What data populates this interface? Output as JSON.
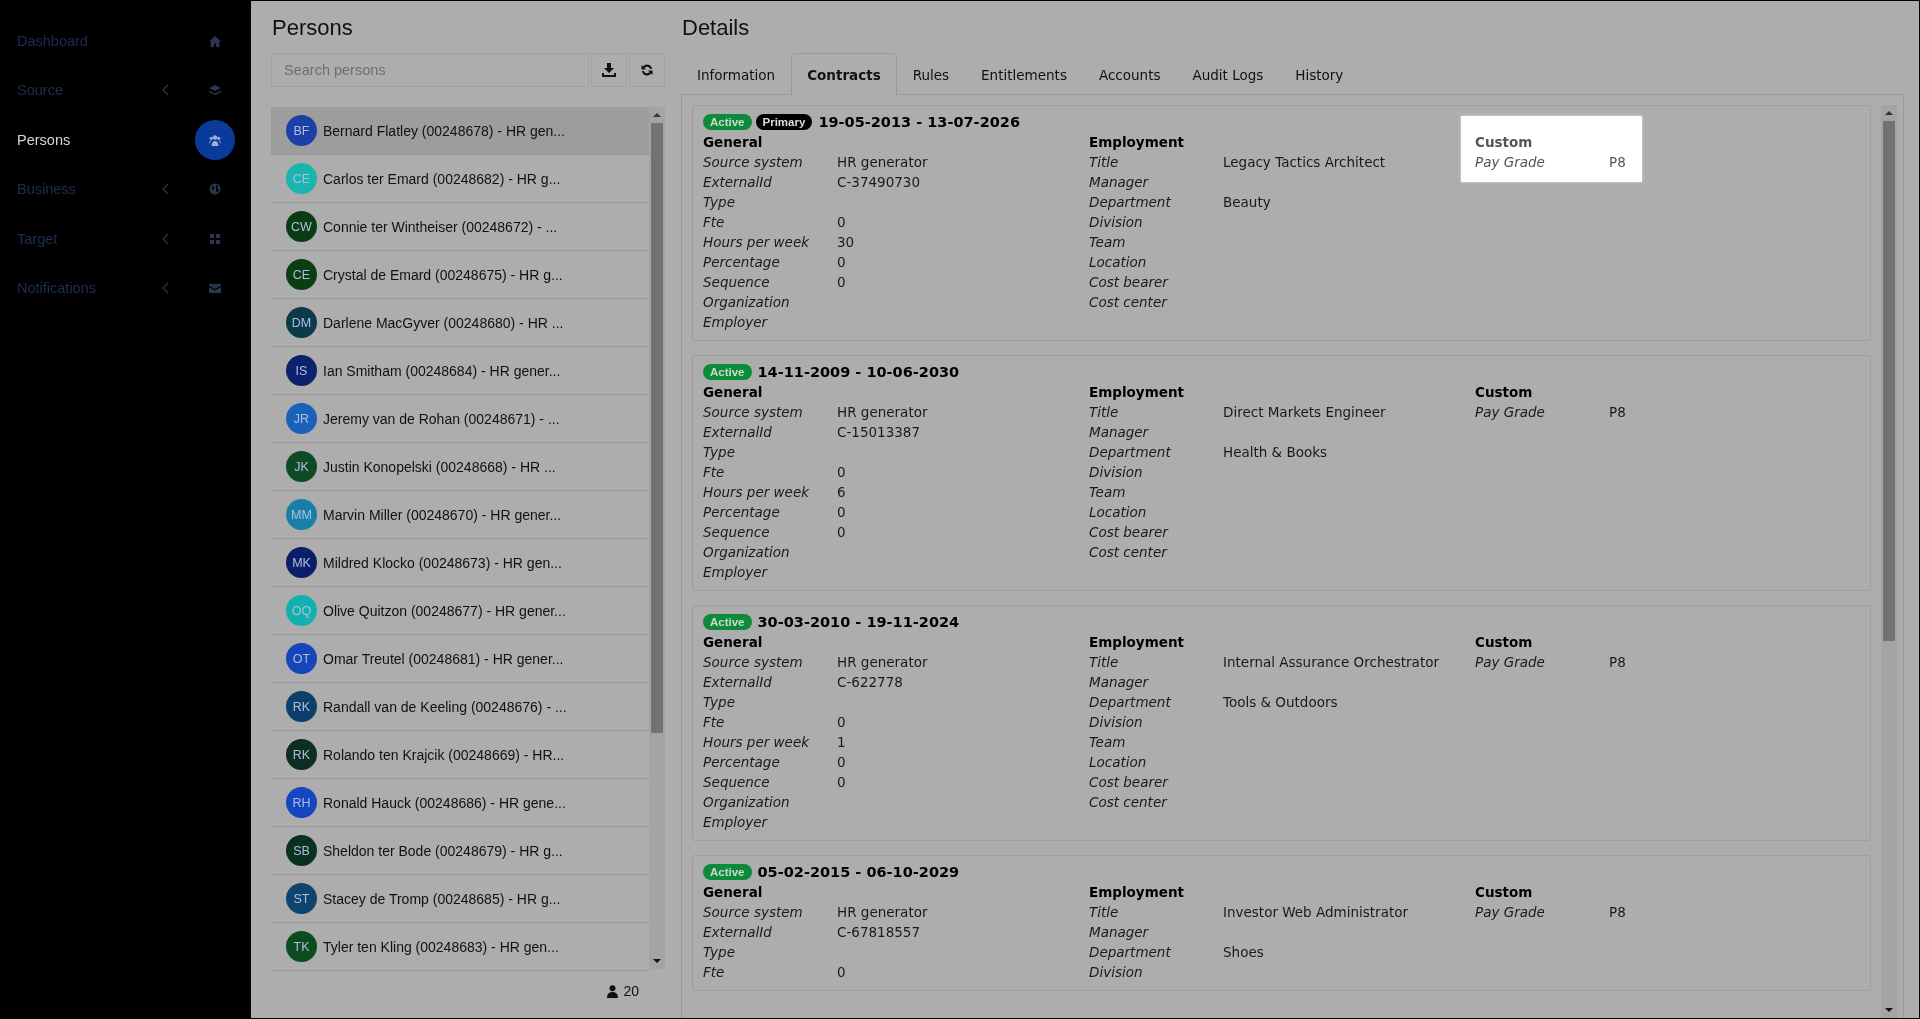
{
  "sidebar": {
    "items": [
      {
        "label": "Dashboard",
        "expandable": false,
        "selected": false
      },
      {
        "label": "Source",
        "expandable": true,
        "selected": false
      },
      {
        "label": "Persons",
        "expandable": false,
        "selected": true
      },
      {
        "label": "Business",
        "expandable": true,
        "selected": false
      },
      {
        "label": "Target",
        "expandable": true,
        "selected": false
      },
      {
        "label": "Notifications",
        "expandable": true,
        "selected": false
      }
    ]
  },
  "persons": {
    "title": "Persons",
    "search": {
      "placeholder": "Search persons"
    },
    "items": [
      {
        "initials": "BF",
        "label": "Bernard Flatley (00248678) - HR gen...",
        "color": "#1f3fa8",
        "selected": true
      },
      {
        "initials": "CE",
        "label": "Carlos ter Emard (00248682) - HR g...",
        "color": "#1bb5b0",
        "selected": false
      },
      {
        "initials": "CW",
        "label": "Connie ter Wintheiser (00248672) - ...",
        "color": "#0a3b12",
        "selected": false
      },
      {
        "initials": "CE",
        "label": "Crystal de Emard (00248675) - HR g...",
        "color": "#0b3d10",
        "selected": false
      },
      {
        "initials": "DM",
        "label": "Darlene MacGyver (00248680) - HR ...",
        "color": "#0c3a4a",
        "selected": false
      },
      {
        "initials": "IS",
        "label": "Ian Smitham (00248684) - HR gener...",
        "color": "#0c226a",
        "selected": false
      },
      {
        "initials": "JR",
        "label": "Jeremy van de Rohan (00248671) - ...",
        "color": "#1a62b8",
        "selected": false
      },
      {
        "initials": "JK",
        "label": "Justin Konopelski (00248668) - HR ...",
        "color": "#0e4a25",
        "selected": false
      },
      {
        "initials": "MM",
        "label": "Marvin Miller (00248670) - HR gener...",
        "color": "#1a7fa6",
        "selected": false
      },
      {
        "initials": "MK",
        "label": "Mildred Klocko (00248673) - HR gen...",
        "color": "#0b1f68",
        "selected": false
      },
      {
        "initials": "OQ",
        "label": "Olive Quitzon (00248677) - HR gener...",
        "color": "#14b0ad",
        "selected": false
      },
      {
        "initials": "OT",
        "label": "Omar Treutel (00248681) - HR gener...",
        "color": "#1545b8",
        "selected": false
      },
      {
        "initials": "RK",
        "label": "Randall van de Keeling (00248676) - ...",
        "color": "#0d3f6a",
        "selected": false
      },
      {
        "initials": "RK",
        "label": "Rolando ten Krajcik (00248669) - HR...",
        "color": "#0d2e22",
        "selected": false
      },
      {
        "initials": "RH",
        "label": "Ronald Hauck (00248686) - HR gene...",
        "color": "#1545c0",
        "selected": false
      },
      {
        "initials": "SB",
        "label": "Sheldon ter Bode (00248679) - HR g...",
        "color": "#0a3020",
        "selected": false
      },
      {
        "initials": "ST",
        "label": "Stacey de Tromp (00248685) - HR g...",
        "color": "#0e446e",
        "selected": false
      },
      {
        "initials": "TK",
        "label": "Tyler ten Kling (00248683) - HR gen...",
        "color": "#0c4a1f",
        "selected": false
      }
    ],
    "count": "20"
  },
  "details": {
    "title": "Details",
    "tabs": [
      {
        "label": "Information",
        "selected": false
      },
      {
        "label": "Contracts",
        "selected": true
      },
      {
        "label": "Rules",
        "selected": false
      },
      {
        "label": "Entitlements",
        "selected": false
      },
      {
        "label": "Accounts",
        "selected": false
      },
      {
        "label": "Audit Logs",
        "selected": false
      },
      {
        "label": "History",
        "selected": false
      }
    ],
    "contracts": [
      {
        "badges": [
          {
            "label": "Active",
            "kind": "active"
          },
          {
            "label": "Primary",
            "kind": "primary"
          }
        ],
        "period": "19-05-2013 - 13-07-2026",
        "sections": [
          {
            "title": "General",
            "highlighted": false,
            "fields": [
              {
                "label": "Source system",
                "value": "HR generator"
              },
              {
                "label": "ExternalId",
                "value": "C-37490730"
              },
              {
                "label": "Type"
              },
              {
                "label": "Fte",
                "value": "0"
              },
              {
                "label": "Hours per week",
                "value": "30"
              },
              {
                "label": "Percentage",
                "value": "0"
              },
              {
                "label": "Sequence",
                "value": "0"
              },
              {
                "label": "Organization"
              },
              {
                "label": "Employer"
              }
            ]
          },
          {
            "title": "Employment",
            "highlighted": false,
            "fields": [
              {
                "label": "Title",
                "value": "Legacy Tactics Architect"
              },
              {
                "label": "Manager"
              },
              {
                "label": "Department",
                "value": "Beauty"
              },
              {
                "label": "Division"
              },
              {
                "label": "Team"
              },
              {
                "label": "Location"
              },
              {
                "label": "Cost bearer"
              },
              {
                "label": "Cost center"
              }
            ]
          },
          {
            "title": "Custom",
            "highlighted": true,
            "fields": [
              {
                "label": "Pay Grade",
                "value": "P8"
              }
            ]
          }
        ]
      },
      {
        "badges": [
          {
            "label": "Active",
            "kind": "active"
          }
        ],
        "period": "14-11-2009 - 10-06-2030",
        "sections": [
          {
            "title": "General",
            "highlighted": false,
            "fields": [
              {
                "label": "Source system",
                "value": "HR generator"
              },
              {
                "label": "ExternalId",
                "value": "C-15013387"
              },
              {
                "label": "Type"
              },
              {
                "label": "Fte",
                "value": "0"
              },
              {
                "label": "Hours per week",
                "value": "6"
              },
              {
                "label": "Percentage",
                "value": "0"
              },
              {
                "label": "Sequence",
                "value": "0"
              },
              {
                "label": "Organization"
              },
              {
                "label": "Employer"
              }
            ]
          },
          {
            "title": "Employment",
            "highlighted": false,
            "fields": [
              {
                "label": "Title",
                "value": "Direct Markets Engineer"
              },
              {
                "label": "Manager"
              },
              {
                "label": "Department",
                "value": "Health & Books"
              },
              {
                "label": "Division"
              },
              {
                "label": "Team"
              },
              {
                "label": "Location"
              },
              {
                "label": "Cost bearer"
              },
              {
                "label": "Cost center"
              }
            ]
          },
          {
            "title": "Custom",
            "highlighted": false,
            "fields": [
              {
                "label": "Pay Grade",
                "value": "P8"
              }
            ]
          }
        ]
      },
      {
        "badges": [
          {
            "label": "Active",
            "kind": "active"
          }
        ],
        "period": "30-03-2010 - 19-11-2024",
        "sections": [
          {
            "title": "General",
            "highlighted": false,
            "fields": [
              {
                "label": "Source system",
                "value": "HR generator"
              },
              {
                "label": "ExternalId",
                "value": "C-622778"
              },
              {
                "label": "Type"
              },
              {
                "label": "Fte",
                "value": "0"
              },
              {
                "label": "Hours per week",
                "value": "1"
              },
              {
                "label": "Percentage",
                "value": "0"
              },
              {
                "label": "Sequence",
                "value": "0"
              },
              {
                "label": "Organization"
              },
              {
                "label": "Employer"
              }
            ]
          },
          {
            "title": "Employment",
            "highlighted": false,
            "fields": [
              {
                "label": "Title",
                "value": "Internal Assurance Orchestrator"
              },
              {
                "label": "Manager"
              },
              {
                "label": "Department",
                "value": "Tools & Outdoors"
              },
              {
                "label": "Division"
              },
              {
                "label": "Team"
              },
              {
                "label": "Location"
              },
              {
                "label": "Cost bearer"
              },
              {
                "label": "Cost center"
              }
            ]
          },
          {
            "title": "Custom",
            "highlighted": false,
            "fields": [
              {
                "label": "Pay Grade",
                "value": "P8"
              }
            ]
          }
        ]
      },
      {
        "badges": [
          {
            "label": "Active",
            "kind": "active"
          }
        ],
        "period": "05-02-2015 - 06-10-2029",
        "sections": [
          {
            "title": "General",
            "highlighted": false,
            "fields": [
              {
                "label": "Source system",
                "value": "HR generator"
              },
              {
                "label": "ExternalId",
                "value": "C-67818557"
              },
              {
                "label": "Type"
              },
              {
                "label": "Fte",
                "value": "0"
              }
            ]
          },
          {
            "title": "Employment",
            "highlighted": false,
            "fields": [
              {
                "label": "Title",
                "value": "Investor Web Administrator"
              },
              {
                "label": "Manager"
              },
              {
                "label": "Department",
                "value": "Shoes"
              },
              {
                "label": "Division"
              }
            ]
          },
          {
            "title": "Custom",
            "highlighted": false,
            "fields": [
              {
                "label": "Pay Grade",
                "value": "P8"
              }
            ]
          }
        ]
      }
    ]
  }
}
